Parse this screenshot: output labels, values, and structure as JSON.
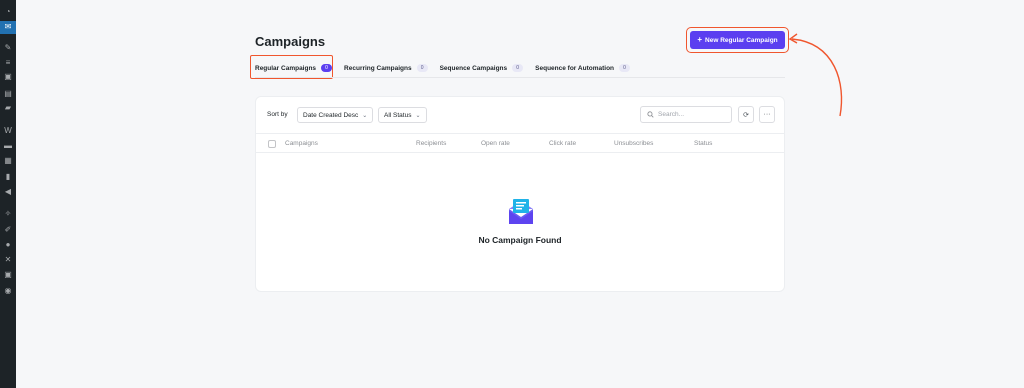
{
  "page": {
    "title": "Campaigns",
    "new_button_label": "New Regular Campaign",
    "new_button_icon": "plus-icon"
  },
  "tabs": [
    {
      "label": "Regular Campaigns",
      "count": "0",
      "active": true
    },
    {
      "label": "Recurring Campaigns",
      "count": "0",
      "active": false
    },
    {
      "label": "Sequence Campaigns",
      "count": "0",
      "active": false
    },
    {
      "label": "Sequence for Automation",
      "count": "0",
      "active": false
    }
  ],
  "toolbar": {
    "sort_label": "Sort by",
    "sort_value": "Date Created Desc",
    "status_value": "All Status",
    "search_placeholder": "Search..."
  },
  "table": {
    "columns": [
      "Campaigns",
      "Recipients",
      "Open rate",
      "Click rate",
      "Unsubscribes",
      "Status"
    ]
  },
  "empty_state": {
    "message": "No Campaign Found",
    "icon": "envelope-icon"
  },
  "colors": {
    "accent": "#5b3ff0",
    "highlight": "#f0562e",
    "wp_sidebar": "#1d2327",
    "wp_active": "#2271b1"
  }
}
